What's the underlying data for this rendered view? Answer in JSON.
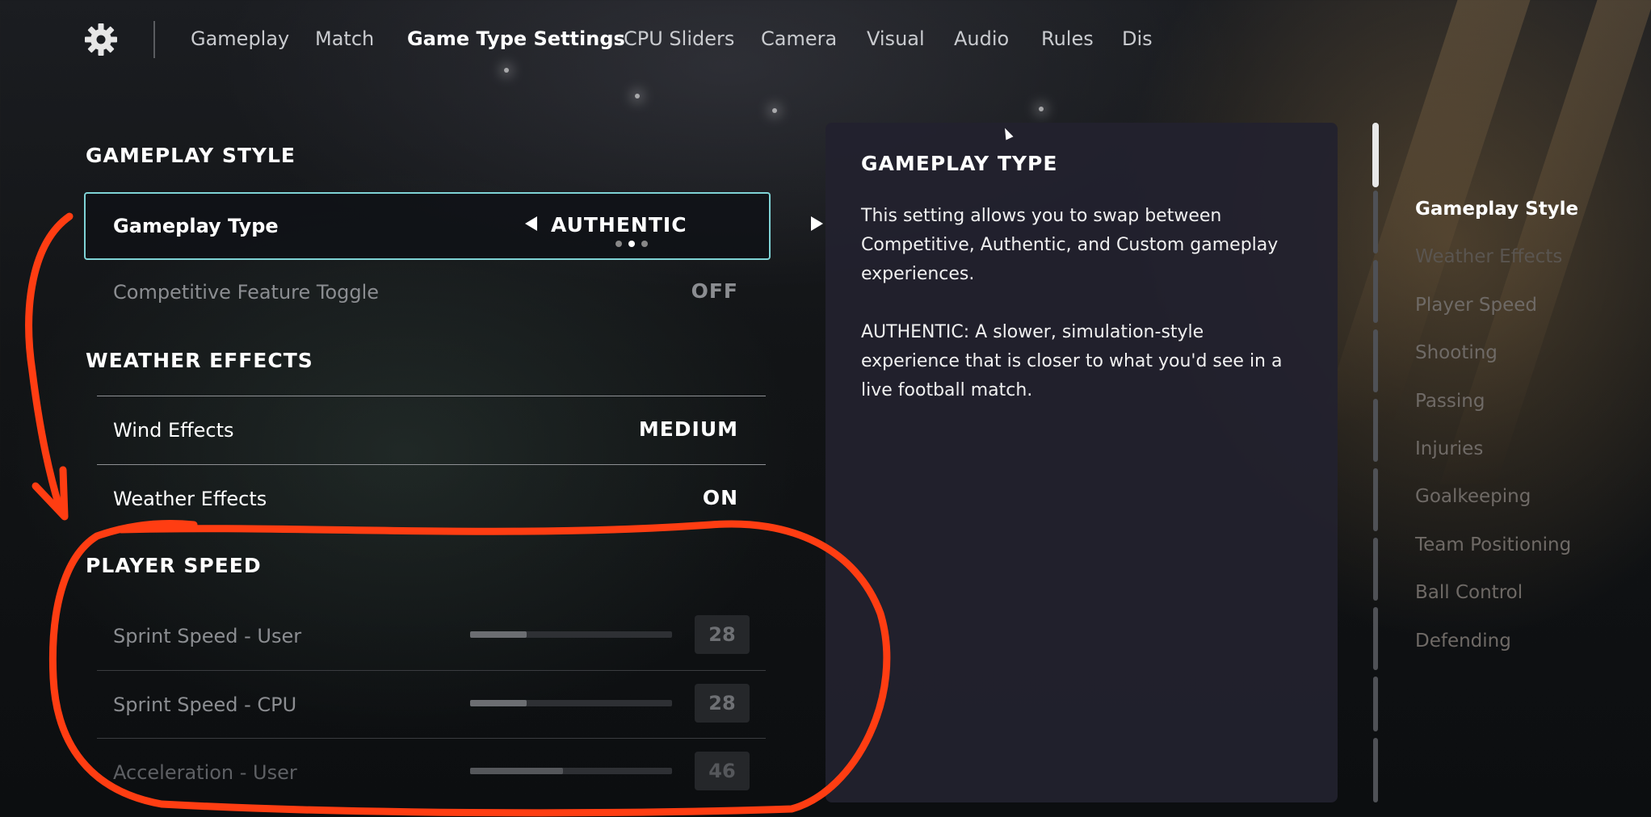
{
  "nav": {
    "tabs": [
      {
        "label": "Gameplay"
      },
      {
        "label": "Match"
      },
      {
        "label": "Game Type Settings"
      },
      {
        "label": "CPU Sliders"
      },
      {
        "label": "Camera"
      },
      {
        "label": "Visual"
      },
      {
        "label": "Audio"
      },
      {
        "label": "Rules"
      },
      {
        "label": "Dis"
      }
    ],
    "active_tab": "Game Type Settings",
    "settings_icon": "gear-icon"
  },
  "sections": {
    "gameplay_style": {
      "title": "GAMEPLAY STYLE",
      "gameplay_type": {
        "label": "Gameplay Type",
        "value": "AUTHENTIC",
        "option_count": 3,
        "selected_option_index": 1
      },
      "competitive_toggle": {
        "label": "Competitive Feature Toggle",
        "value": "OFF"
      }
    },
    "weather_effects": {
      "title": "WEATHER EFFECTS",
      "wind": {
        "label": "Wind Effects",
        "value": "MEDIUM"
      },
      "weather": {
        "label": "Weather Effects",
        "value": "ON"
      }
    },
    "player_speed": {
      "title": "PLAYER SPEED",
      "sliders": [
        {
          "label": "Sprint Speed - User",
          "value": "28"
        },
        {
          "label": "Sprint Speed - CPU",
          "value": "28"
        },
        {
          "label": "Acceleration - User",
          "value": "46"
        }
      ]
    }
  },
  "info_panel": {
    "title": "GAMEPLAY TYPE",
    "lines_1": [
      "This setting allows you to swap between",
      "Competitive, Authentic, and Custom gameplay",
      "experiences."
    ],
    "lines_2": [
      "AUTHENTIC: A slower, simulation-style",
      "experience that is closer to what you'd see in a",
      "live football match."
    ]
  },
  "index": {
    "items": [
      "Gameplay Style",
      "Weather Effects",
      "Player Speed",
      "Shooting",
      "Passing",
      "Injuries",
      "Goalkeeping",
      "Team Positioning",
      "Ball Control",
      "Defending"
    ],
    "active": "Gameplay Style"
  },
  "colors": {
    "selection_border": "#7fd3d6",
    "annotation_stroke": "#ff3d12",
    "panel_bg": "#22212e"
  }
}
